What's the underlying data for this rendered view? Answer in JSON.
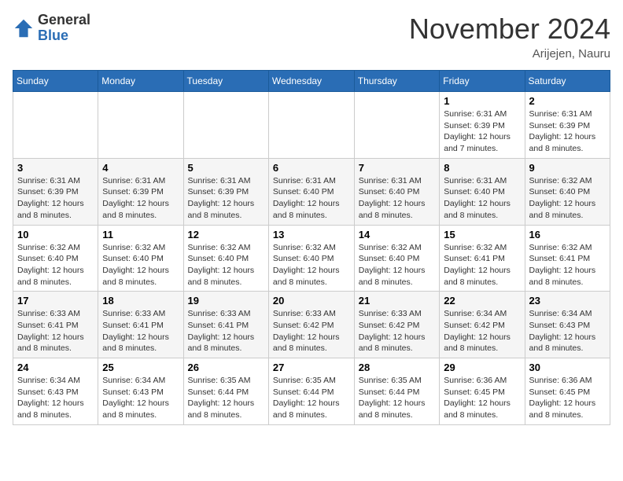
{
  "header": {
    "logo_general": "General",
    "logo_blue": "Blue",
    "month_title": "November 2024",
    "location": "Arijejen, Nauru"
  },
  "days_of_week": [
    "Sunday",
    "Monday",
    "Tuesday",
    "Wednesday",
    "Thursday",
    "Friday",
    "Saturday"
  ],
  "weeks": [
    [
      {
        "day": "",
        "info": ""
      },
      {
        "day": "",
        "info": ""
      },
      {
        "day": "",
        "info": ""
      },
      {
        "day": "",
        "info": ""
      },
      {
        "day": "",
        "info": ""
      },
      {
        "day": "1",
        "info": "Sunrise: 6:31 AM\nSunset: 6:39 PM\nDaylight: 12 hours and 7 minutes."
      },
      {
        "day": "2",
        "info": "Sunrise: 6:31 AM\nSunset: 6:39 PM\nDaylight: 12 hours and 8 minutes."
      }
    ],
    [
      {
        "day": "3",
        "info": "Sunrise: 6:31 AM\nSunset: 6:39 PM\nDaylight: 12 hours and 8 minutes."
      },
      {
        "day": "4",
        "info": "Sunrise: 6:31 AM\nSunset: 6:39 PM\nDaylight: 12 hours and 8 minutes."
      },
      {
        "day": "5",
        "info": "Sunrise: 6:31 AM\nSunset: 6:39 PM\nDaylight: 12 hours and 8 minutes."
      },
      {
        "day": "6",
        "info": "Sunrise: 6:31 AM\nSunset: 6:40 PM\nDaylight: 12 hours and 8 minutes."
      },
      {
        "day": "7",
        "info": "Sunrise: 6:31 AM\nSunset: 6:40 PM\nDaylight: 12 hours and 8 minutes."
      },
      {
        "day": "8",
        "info": "Sunrise: 6:31 AM\nSunset: 6:40 PM\nDaylight: 12 hours and 8 minutes."
      },
      {
        "day": "9",
        "info": "Sunrise: 6:32 AM\nSunset: 6:40 PM\nDaylight: 12 hours and 8 minutes."
      }
    ],
    [
      {
        "day": "10",
        "info": "Sunrise: 6:32 AM\nSunset: 6:40 PM\nDaylight: 12 hours and 8 minutes."
      },
      {
        "day": "11",
        "info": "Sunrise: 6:32 AM\nSunset: 6:40 PM\nDaylight: 12 hours and 8 minutes."
      },
      {
        "day": "12",
        "info": "Sunrise: 6:32 AM\nSunset: 6:40 PM\nDaylight: 12 hours and 8 minutes."
      },
      {
        "day": "13",
        "info": "Sunrise: 6:32 AM\nSunset: 6:40 PM\nDaylight: 12 hours and 8 minutes."
      },
      {
        "day": "14",
        "info": "Sunrise: 6:32 AM\nSunset: 6:40 PM\nDaylight: 12 hours and 8 minutes."
      },
      {
        "day": "15",
        "info": "Sunrise: 6:32 AM\nSunset: 6:41 PM\nDaylight: 12 hours and 8 minutes."
      },
      {
        "day": "16",
        "info": "Sunrise: 6:32 AM\nSunset: 6:41 PM\nDaylight: 12 hours and 8 minutes."
      }
    ],
    [
      {
        "day": "17",
        "info": "Sunrise: 6:33 AM\nSunset: 6:41 PM\nDaylight: 12 hours and 8 minutes."
      },
      {
        "day": "18",
        "info": "Sunrise: 6:33 AM\nSunset: 6:41 PM\nDaylight: 12 hours and 8 minutes."
      },
      {
        "day": "19",
        "info": "Sunrise: 6:33 AM\nSunset: 6:41 PM\nDaylight: 12 hours and 8 minutes."
      },
      {
        "day": "20",
        "info": "Sunrise: 6:33 AM\nSunset: 6:42 PM\nDaylight: 12 hours and 8 minutes."
      },
      {
        "day": "21",
        "info": "Sunrise: 6:33 AM\nSunset: 6:42 PM\nDaylight: 12 hours and 8 minutes."
      },
      {
        "day": "22",
        "info": "Sunrise: 6:34 AM\nSunset: 6:42 PM\nDaylight: 12 hours and 8 minutes."
      },
      {
        "day": "23",
        "info": "Sunrise: 6:34 AM\nSunset: 6:43 PM\nDaylight: 12 hours and 8 minutes."
      }
    ],
    [
      {
        "day": "24",
        "info": "Sunrise: 6:34 AM\nSunset: 6:43 PM\nDaylight: 12 hours and 8 minutes."
      },
      {
        "day": "25",
        "info": "Sunrise: 6:34 AM\nSunset: 6:43 PM\nDaylight: 12 hours and 8 minutes."
      },
      {
        "day": "26",
        "info": "Sunrise: 6:35 AM\nSunset: 6:44 PM\nDaylight: 12 hours and 8 minutes."
      },
      {
        "day": "27",
        "info": "Sunrise: 6:35 AM\nSunset: 6:44 PM\nDaylight: 12 hours and 8 minutes."
      },
      {
        "day": "28",
        "info": "Sunrise: 6:35 AM\nSunset: 6:44 PM\nDaylight: 12 hours and 8 minutes."
      },
      {
        "day": "29",
        "info": "Sunrise: 6:36 AM\nSunset: 6:45 PM\nDaylight: 12 hours and 8 minutes."
      },
      {
        "day": "30",
        "info": "Sunrise: 6:36 AM\nSunset: 6:45 PM\nDaylight: 12 hours and 8 minutes."
      }
    ]
  ]
}
